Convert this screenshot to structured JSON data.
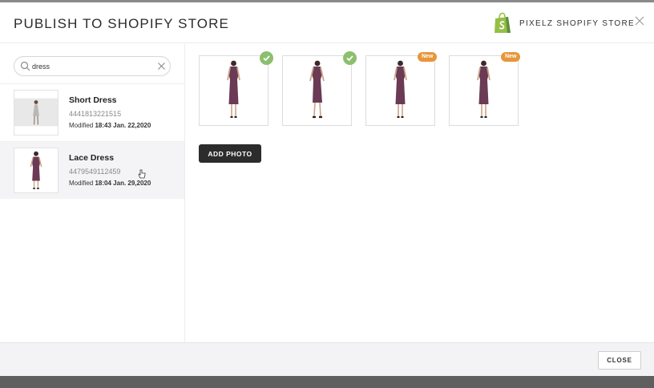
{
  "modal": {
    "title": "PUBLISH TO SHOPIFY STORE",
    "store_name": "PIXELZ SHOPIFY STORE",
    "store_icon": "shopify-bag-icon",
    "close_icon": "close-icon"
  },
  "search": {
    "value": "dress",
    "icon": "search-icon",
    "clear_icon": "clear-icon"
  },
  "products": [
    {
      "name": "Short Dress",
      "id": "4441813221515",
      "modified_prefix": "Modified",
      "modified_date": "18:43 Jan. 22,2020",
      "selected": false
    },
    {
      "name": "Lace Dress",
      "id": "4479549112459",
      "modified_prefix": "Modified",
      "modified_date": "18:04 Jan. 29,2020",
      "selected": true
    }
  ],
  "photos": [
    {
      "status": "published",
      "status_icon": "check-icon"
    },
    {
      "status": "published",
      "status_icon": "check-icon"
    },
    {
      "status": "new",
      "badge": "New"
    },
    {
      "status": "new",
      "badge": "New"
    }
  ],
  "actions": {
    "add_photo": "ADD PHOTO",
    "close": "CLOSE"
  },
  "colors": {
    "check_green": "#8cbf6e",
    "new_orange": "#e7963b",
    "shopify_green": "#95bf47",
    "dress_purple": "#6b3a55"
  }
}
